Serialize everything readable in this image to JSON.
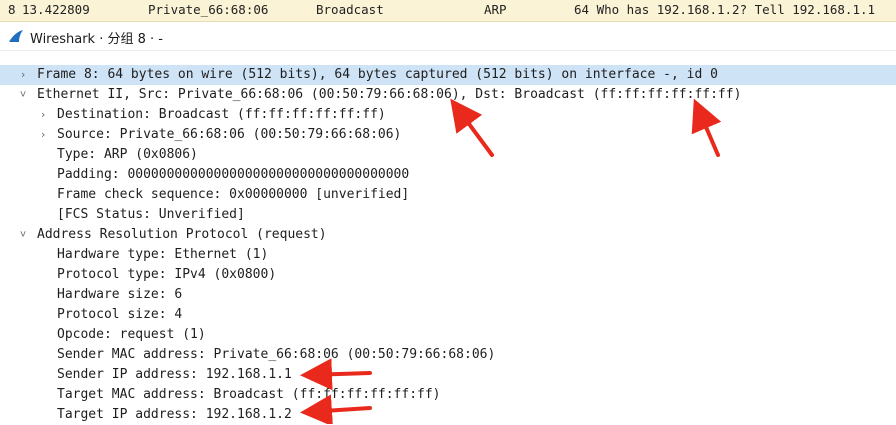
{
  "packet_list_row": {
    "no": "8",
    "time": "13.422809",
    "source": "Private_66:68:06",
    "destination": "Broadcast",
    "protocol": "ARP",
    "info": "64 Who has 192.168.1.2? Tell 192.168.1.1"
  },
  "window": {
    "title": "Wireshark · 分组 8 · -"
  },
  "details": [
    {
      "text": "Frame 8: 64 bytes on wire (512 bits), 64 bytes captured (512 bits) on interface -, id 0",
      "expander": "collapsed"
    },
    {
      "text": "Ethernet II, Src: Private_66:68:06 (00:50:79:66:68:06), Dst: Broadcast (ff:ff:ff:ff:ff:ff)",
      "expander": "expanded"
    },
    {
      "text": "Destination: Broadcast (ff:ff:ff:ff:ff:ff)",
      "expander": "collapsed"
    },
    {
      "text": "Source: Private_66:68:06 (00:50:79:66:68:06)",
      "expander": "collapsed"
    },
    {
      "text": "Type: ARP (0x0806)",
      "expander": "none"
    },
    {
      "text": "Padding: 000000000000000000000000000000000000",
      "expander": "none"
    },
    {
      "text": "Frame check sequence: 0x00000000 [unverified]",
      "expander": "none"
    },
    {
      "text": "[FCS Status: Unverified]",
      "expander": "none"
    },
    {
      "text": "Address Resolution Protocol (request)",
      "expander": "expanded"
    },
    {
      "text": "Hardware type: Ethernet (1)",
      "expander": "none"
    },
    {
      "text": "Protocol type: IPv4 (0x0800)",
      "expander": "none"
    },
    {
      "text": "Hardware size: 6",
      "expander": "none"
    },
    {
      "text": "Protocol size: 4",
      "expander": "none"
    },
    {
      "text": "Opcode: request (1)",
      "expander": "none"
    },
    {
      "text": "Sender MAC address: Private_66:68:06 (00:50:79:66:68:06)",
      "expander": "none"
    },
    {
      "text": "Sender IP address: 192.168.1.1",
      "expander": "none"
    },
    {
      "text": "Target MAC address: Broadcast (ff:ff:ff:ff:ff:ff)",
      "expander": "none"
    },
    {
      "text": "Target IP address: 192.168.1.2",
      "expander": "none"
    }
  ],
  "icons": {
    "expanded": "chevron-down-icon",
    "collapsed": "chevron-right-icon",
    "app": "wireshark-fin-icon"
  },
  "colors": {
    "selected_row": "#cfe3f6",
    "packet_row": "#fbf3d6",
    "annotation_arrow": "#e8291c"
  }
}
